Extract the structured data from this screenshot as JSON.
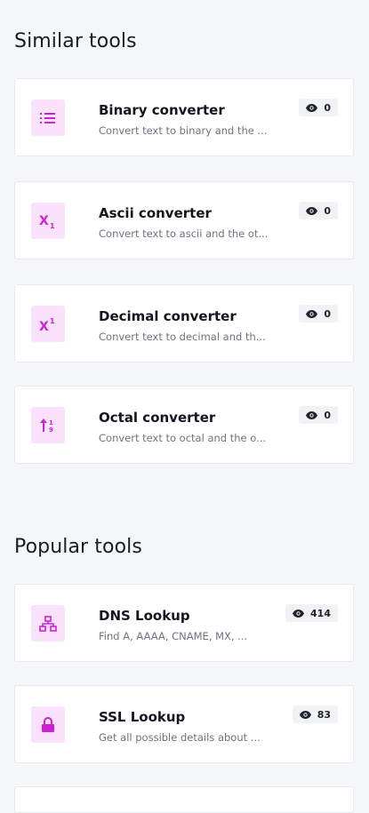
{
  "similar": {
    "title": "Similar tools",
    "tools": [
      {
        "title": "Binary converter",
        "desc": "Convert text to binary and the ...",
        "views": "0",
        "icon": "list-icon"
      },
      {
        "title": "Ascii converter",
        "desc": "Convert text to ascii and the ot...",
        "views": "0",
        "icon": "subscript-icon"
      },
      {
        "title": "Decimal converter",
        "desc": "Convert text to decimal and th...",
        "views": "0",
        "icon": "superscript-icon"
      },
      {
        "title": "Octal converter",
        "desc": "Convert text to octal and the o...",
        "views": "0",
        "icon": "sort-numeric-icon"
      }
    ]
  },
  "popular": {
    "title": "Popular tools",
    "tools": [
      {
        "title": "DNS Lookup",
        "desc": "Find A, AAAA, CNAME, MX, ...",
        "views": "414",
        "icon": "network-icon"
      },
      {
        "title": "SSL Lookup",
        "desc": "Get all possible details about ...",
        "views": "83",
        "icon": "lock-icon"
      }
    ]
  },
  "colors": {
    "accent": "#d11fd6",
    "icon_bg": "#fae2fc",
    "page_bg": "#f5f6f9"
  }
}
